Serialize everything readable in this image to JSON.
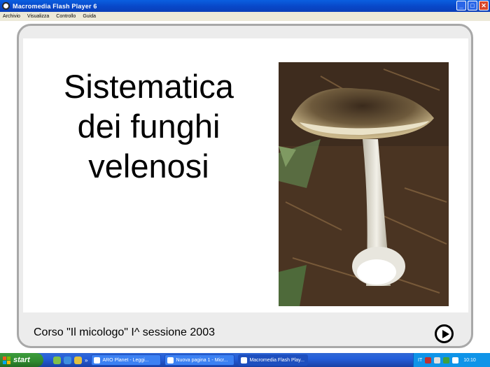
{
  "window": {
    "title": "Macromedia Flash Player 6"
  },
  "menu": {
    "items": [
      "Archivio",
      "Visualizza",
      "Controllo",
      "Guida"
    ]
  },
  "slide": {
    "title_line1": "Sistematica",
    "title_line2": "dei funghi",
    "title_line3": "velenosi",
    "footer": "Corso \"Il micologo\" I^ sessione 2003"
  },
  "taskbar": {
    "start_label": "start",
    "tasks": [
      "ARO Planet - Leggi...",
      "Nuova pagina 1 - Micr...",
      "Macromedia Flash Play..."
    ],
    "tray_lang": "IT",
    "clock": "10:10"
  },
  "colors": {
    "titlebar": "#0a50d8",
    "frame_border": "#a8a8a8",
    "frame_bg": "#ececec",
    "taskbar": "#245edb",
    "start": "#2f8a2f"
  }
}
